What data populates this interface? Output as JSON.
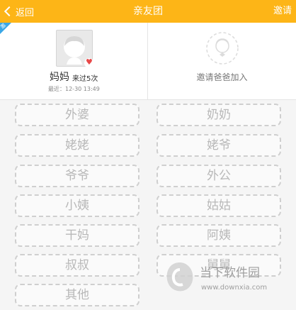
{
  "header": {
    "back_label": "返回",
    "title": "亲友团",
    "invite_label": "邀请",
    "bg_color": "#fdb517"
  },
  "corner_badge": "邀",
  "member": {
    "name": "妈妈",
    "visit_count": "来过5次",
    "recent": "最近：12-30 13:49"
  },
  "invite_card": {
    "label": "邀请爸爸加入"
  },
  "slots": {
    "left": [
      "外婆",
      "姥姥",
      "爷爷",
      "小姨",
      "干妈",
      "叔叔",
      "其他"
    ],
    "right": [
      "奶奶",
      "姥爷",
      "外公",
      "姑姑",
      "阿姨",
      "舅舅"
    ]
  },
  "watermark": {
    "title": "当下软件园",
    "url": "www.downxia.com"
  }
}
